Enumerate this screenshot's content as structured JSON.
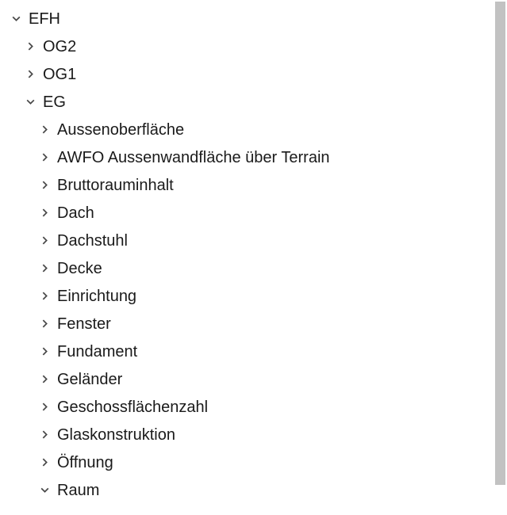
{
  "tree": {
    "root": {
      "label": "EFH",
      "expanded": true,
      "children": [
        {
          "label": "OG2",
          "expanded": false
        },
        {
          "label": "OG1",
          "expanded": false
        },
        {
          "label": "EG",
          "expanded": true,
          "children": [
            {
              "label": "Aussenoberfläche",
              "expanded": false
            },
            {
              "label": "AWFO Aussenwandfläche über Terrain",
              "expanded": false
            },
            {
              "label": "Bruttorauminhalt",
              "expanded": false
            },
            {
              "label": "Dach",
              "expanded": false
            },
            {
              "label": "Dachstuhl",
              "expanded": false
            },
            {
              "label": "Decke",
              "expanded": false
            },
            {
              "label": "Einrichtung",
              "expanded": false
            },
            {
              "label": "Fenster",
              "expanded": false
            },
            {
              "label": "Fundament",
              "expanded": false
            },
            {
              "label": "Geländer",
              "expanded": false
            },
            {
              "label": "Geschossflächenzahl",
              "expanded": false
            },
            {
              "label": "Glaskonstruktion",
              "expanded": false
            },
            {
              "label": "Öffnung",
              "expanded": false
            },
            {
              "label": "Raum",
              "expanded": true
            }
          ]
        }
      ]
    }
  }
}
